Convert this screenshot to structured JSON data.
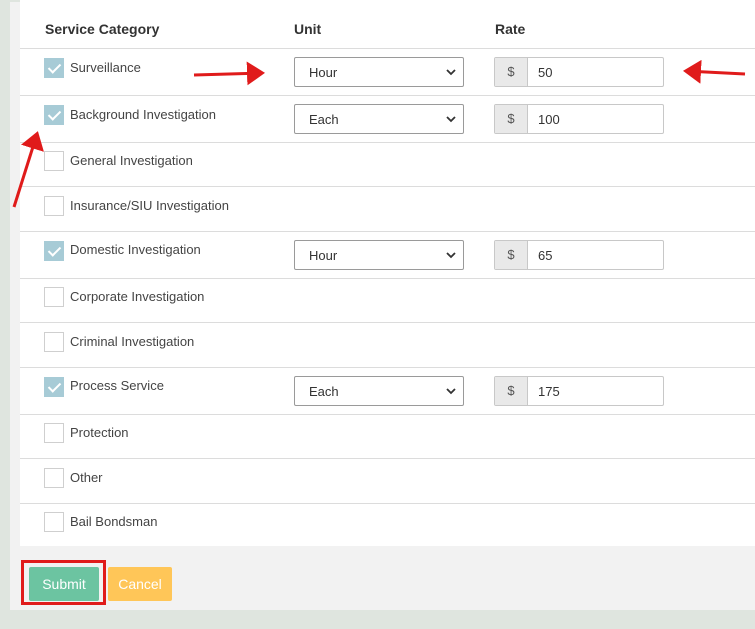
{
  "table": {
    "headers": {
      "category": "Service Category",
      "unit": "Unit",
      "rate": "Rate"
    },
    "currency_symbol": "$",
    "rows": [
      {
        "label": "Surveillance",
        "checked": true,
        "unit": "Hour",
        "rate": "50"
      },
      {
        "label": "Background Investigation",
        "checked": true,
        "unit": "Each",
        "rate": "100"
      },
      {
        "label": "General Investigation",
        "checked": false
      },
      {
        "label": "Insurance/SIU Investigation",
        "checked": false
      },
      {
        "label": "Domestic Investigation",
        "checked": true,
        "unit": "Hour",
        "rate": "65"
      },
      {
        "label": "Corporate Investigation",
        "checked": false
      },
      {
        "label": "Criminal Investigation",
        "checked": false
      },
      {
        "label": "Process Service",
        "checked": true,
        "unit": "Each",
        "rate": "175"
      },
      {
        "label": "Protection",
        "checked": false
      },
      {
        "label": "Other",
        "checked": false
      },
      {
        "label": "Bail Bondsman",
        "checked": false
      }
    ]
  },
  "actions": {
    "submit_label": "Submit",
    "cancel_label": "Cancel"
  },
  "colors": {
    "checkbox_checked": "#a7cbd6",
    "submit": "#6cc4a1",
    "cancel": "#ffc658",
    "annotation": "#e01b1b"
  }
}
